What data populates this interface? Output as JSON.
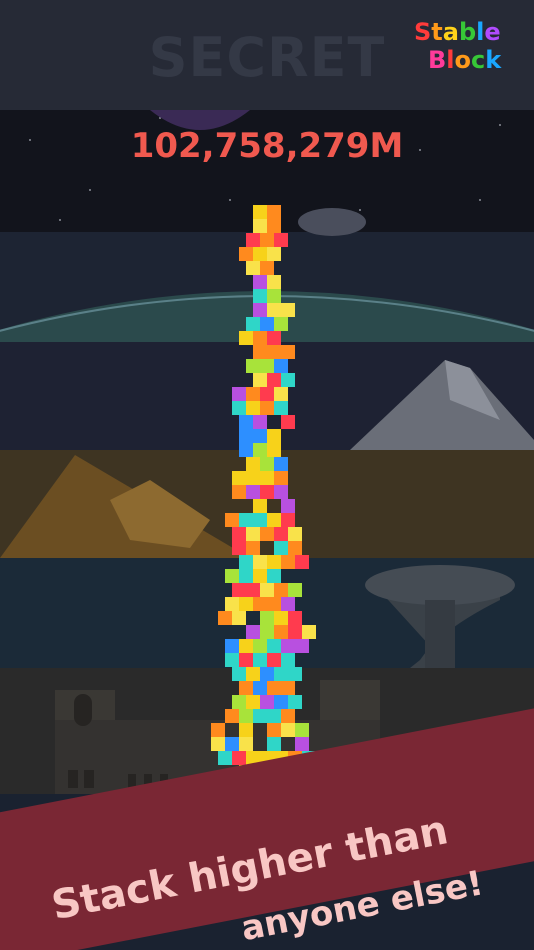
{
  "screen": {
    "level_label": "SECRET",
    "height_score": "102,758,279M",
    "tagline_line1": "Stack higher than",
    "tagline_line2": "anyone else!"
  },
  "logo": {
    "line1_letters": [
      "S",
      "t",
      "a",
      "b",
      "l",
      "e"
    ],
    "line2_letters": [
      "B",
      "l",
      "o",
      "c",
      "k"
    ],
    "line1_colors": [
      "#ff3b3b",
      "#ff9a1a",
      "#ffd21a",
      "#37c837",
      "#1aa7ff",
      "#b04bff"
    ],
    "line2_colors": [
      "#ff3b9a",
      "#ff3b3b",
      "#ff9a1a",
      "#37c837",
      "#1aa7ff"
    ]
  },
  "colors": {
    "block_palette": [
      "#f7d21a",
      "#a8e33a",
      "#b850e0",
      "#ff8a1e",
      "#2fd6c8",
      "#ff3b4e",
      "#2d8fff",
      "#f9e24a"
    ],
    "score": "#f0594f",
    "banner": "#7a2734",
    "tagline": "#f8c7c4"
  }
}
